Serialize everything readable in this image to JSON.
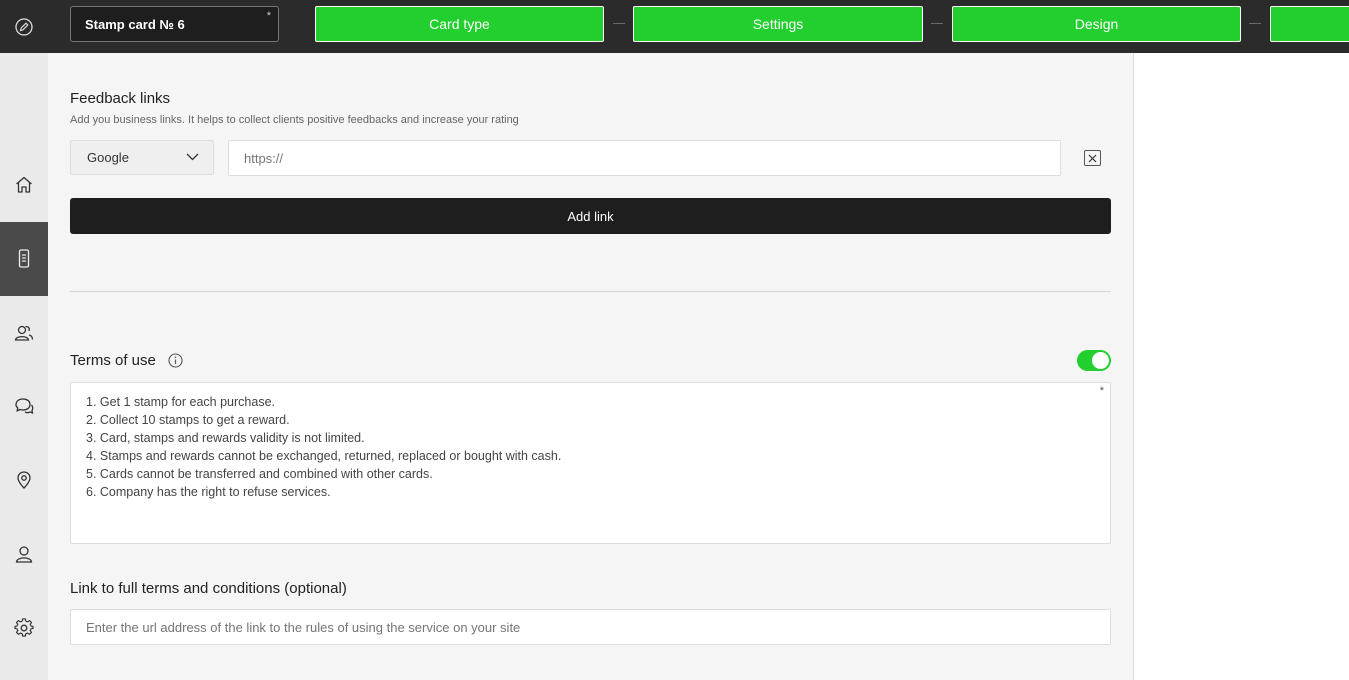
{
  "header": {
    "card_name": "Stamp card № 6",
    "required_mark": "*",
    "steps": [
      {
        "label": "Card type"
      },
      {
        "label": "Settings"
      },
      {
        "label": "Design"
      },
      {
        "label": ""
      }
    ],
    "step_color": "#22cf2e"
  },
  "sidebar": {
    "items": [
      {
        "icon": "home-icon"
      },
      {
        "icon": "card-icon",
        "active": true
      },
      {
        "icon": "clients-icon"
      },
      {
        "icon": "chat-icon"
      },
      {
        "icon": "location-icon"
      },
      {
        "icon": "user-icon"
      },
      {
        "icon": "gear-icon"
      }
    ]
  },
  "feedback": {
    "title": "Feedback links",
    "subtitle": "Add you business links. It helps to collect clients positive feedbacks and increase your rating",
    "selected_source": "Google",
    "url_placeholder": "https://",
    "add_link_label": "Add link"
  },
  "terms": {
    "title": "Terms of use",
    "enabled": true,
    "required_mark": "*",
    "lines": [
      "1. Get 1 stamp for each purchase.",
      "2. Collect 10 stamps to get a reward.",
      "3. Card, stamps and rewards validity is not limited.",
      "4. Stamps and rewards cannot be exchanged, returned, replaced or bought with cash.",
      "5. Cards cannot be transferred and combined with other cards.",
      "6. Company has the right to refuse services."
    ]
  },
  "full_terms": {
    "title": "Link to full terms and conditions (optional)",
    "placeholder": "Enter the url address of the link to the rules of using the service on your site"
  }
}
